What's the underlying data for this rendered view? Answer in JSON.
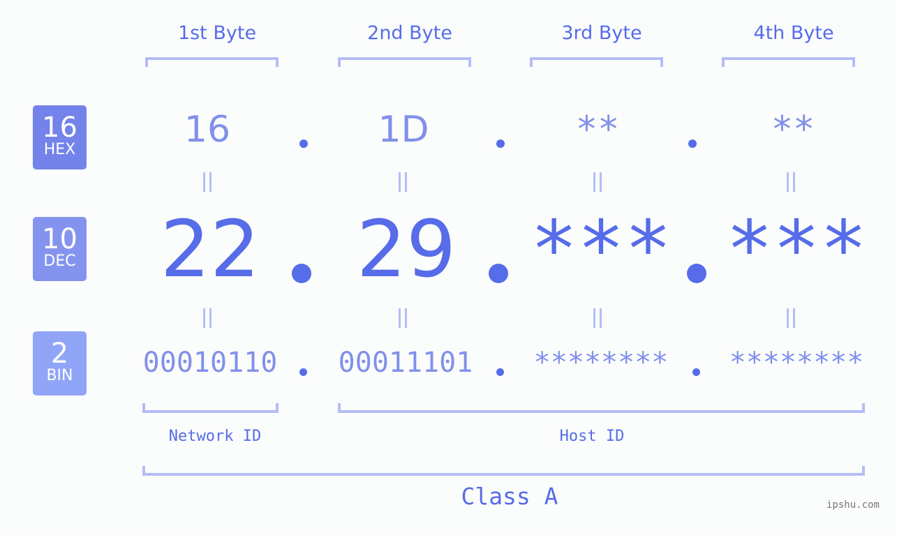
{
  "bytes": [
    {
      "header": "1st Byte",
      "hex": "16",
      "dec": "22",
      "bin": "00010110"
    },
    {
      "header": "2nd Byte",
      "hex": "1D",
      "dec": "29",
      "bin": "00011101"
    },
    {
      "header": "3rd Byte",
      "hex": "**",
      "dec": "***",
      "bin": "********"
    },
    {
      "header": "4th Byte",
      "hex": "**",
      "dec": "***",
      "bin": "********"
    }
  ],
  "bases": {
    "hex": {
      "number": "16",
      "label": "HEX",
      "color": "#7383ea"
    },
    "dec": {
      "number": "10",
      "label": "DEC",
      "color": "#8494ee"
    },
    "bin": {
      "number": "2",
      "label": "BIN",
      "color": "#90a5f7"
    }
  },
  "sections": {
    "network": "Network ID",
    "host": "Host ID",
    "class": "Class A"
  },
  "watermark": "ipshu.com",
  "colors": {
    "primary": "#566ce8",
    "secondary": "#8190ea",
    "bracket": "#b3bdf6"
  }
}
